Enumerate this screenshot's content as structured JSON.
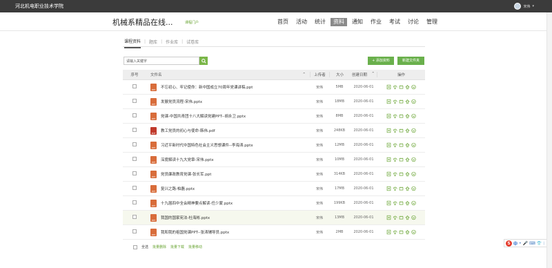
{
  "topbar": {
    "school": "河北机电职业技术学院",
    "user_name": "宋伟"
  },
  "header": {
    "course_title": "机械系精品在线...",
    "portal_link": "课程门户",
    "nav": [
      {
        "label": "首页",
        "active": false
      },
      {
        "label": "活动",
        "active": false
      },
      {
        "label": "统计",
        "active": false
      },
      {
        "label": "资料",
        "active": true
      },
      {
        "label": "通知",
        "active": false
      },
      {
        "label": "作业",
        "active": false
      },
      {
        "label": "考试",
        "active": false
      },
      {
        "label": "讨论",
        "active": false
      },
      {
        "label": "管理",
        "active": false
      }
    ]
  },
  "tabs": [
    {
      "label": "课程资料",
      "active": true
    },
    {
      "label": "题库",
      "active": false
    },
    {
      "label": "作业库",
      "active": false
    },
    {
      "label": "试卷库",
      "active": false
    }
  ],
  "search": {
    "value": "请输入关键字"
  },
  "buttons": {
    "upload": "+ 添加资料",
    "new_folder": "新建文件夹"
  },
  "table": {
    "headers": {
      "seq": "序号",
      "name": "文件名",
      "uploader": "上传者",
      "size": "大小",
      "date": "创建日期",
      "ops": "操作"
    },
    "rows": [
      {
        "name": "不忘初心、牢记使命：新中国成立70周年党课讲稿.ppt",
        "type": "ppt",
        "uploader": "宋伟",
        "size": "5MB",
        "date": "2020-06-01"
      },
      {
        "name": "发展党员流程-宋伟.pptx",
        "type": "ppt",
        "uploader": "宋伟",
        "size": "18MB",
        "date": "2020-06-01"
      },
      {
        "name": "党课-中国共青团十八大解读党建PPT--胡永卫.pptx",
        "type": "ppt",
        "uploader": "宋伟",
        "size": "8MB",
        "date": "2020-06-01"
      },
      {
        "name": "教工党员的初心与使命-韩伟.pdf",
        "type": "pdf",
        "uploader": "宋伟",
        "size": "248KB",
        "date": "2020-06-01"
      },
      {
        "name": "习近平新时代中国特色社会主义思想课件--李海涛.pptx",
        "type": "ppt",
        "uploader": "宋伟",
        "size": "12MB",
        "date": "2020-06-01"
      },
      {
        "name": "深度解读十九大党章-宋伟.pptx",
        "type": "ppt",
        "uploader": "宋伟",
        "size": "10MB",
        "date": "2020-06-01"
      },
      {
        "name": "党员廉政教育党课-张长军.ppt",
        "type": "ppt",
        "uploader": "宋伟",
        "size": "314KB",
        "date": "2020-06-01"
      },
      {
        "name": "复兴之路-柏磊.pptx",
        "type": "ppt",
        "uploader": "宋伟",
        "size": "17MB",
        "date": "2020-06-01"
      },
      {
        "name": "十九届四中全会精神要点解读-任少蒙.pptx",
        "type": "ppt",
        "uploader": "宋伟",
        "size": "199KB",
        "date": "2020-06-01"
      },
      {
        "name": "我国的国家宪法-杜海彬.pptx",
        "type": "ppt",
        "uploader": "宋伟",
        "size": "13MB",
        "date": "2020-06-01",
        "highlight": true
      },
      {
        "name": "我和我的祖国党课PPT--张涛辅导员.pptx",
        "type": "ppt",
        "uploader": "宋伟",
        "size": "2MB",
        "date": "2020-06-01"
      }
    ]
  },
  "footer": {
    "select_all": "全选",
    "batch_delete": "批量删除",
    "batch_download": "批量下载",
    "batch_move": "批量移动"
  },
  "ime": {
    "logo": "S",
    "lang": "中"
  }
}
